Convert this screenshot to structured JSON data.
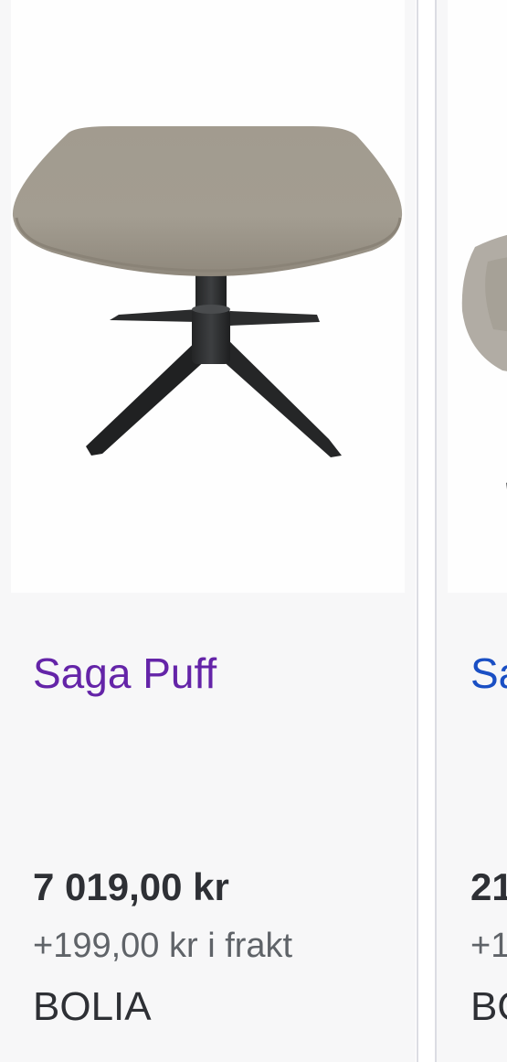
{
  "products": [
    {
      "title": "Saga Puff",
      "price": "7 019,00 kr",
      "shipping": "+199,00 kr i frakt",
      "seller": "BOLIA",
      "image_icon": "ottoman-footstool-image",
      "title_color": "#6424a8"
    },
    {
      "title": "Saga",
      "price": "21",
      "shipping": "+1",
      "seller": "BO",
      "image_icon": "lounge-chair-image",
      "title_color": "#1a4fc4"
    }
  ],
  "colors": {
    "card_background": "#f7f7f8",
    "image_background": "#fefefe",
    "divider": "#dcdde3",
    "price_text": "#2e3035",
    "shipping_text": "#5f6368"
  }
}
